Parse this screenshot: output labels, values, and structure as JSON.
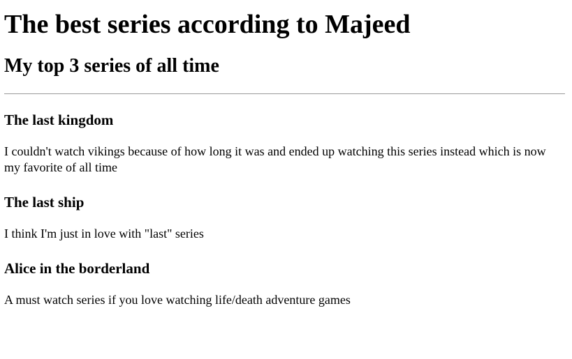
{
  "page": {
    "title": "The best series according to Majeed",
    "subtitle": "My top 3 series of all time"
  },
  "series": [
    {
      "name": "The last kingdom",
      "description": "I couldn't watch vikings because of how long it was and ended up watching this series instead which is now my favorite of all time"
    },
    {
      "name": "The last ship",
      "description": "I think I'm just in love with \"last\" series"
    },
    {
      "name": "Alice in the borderland",
      "description": "A must watch series if you love watching life/death adventure games"
    }
  ]
}
